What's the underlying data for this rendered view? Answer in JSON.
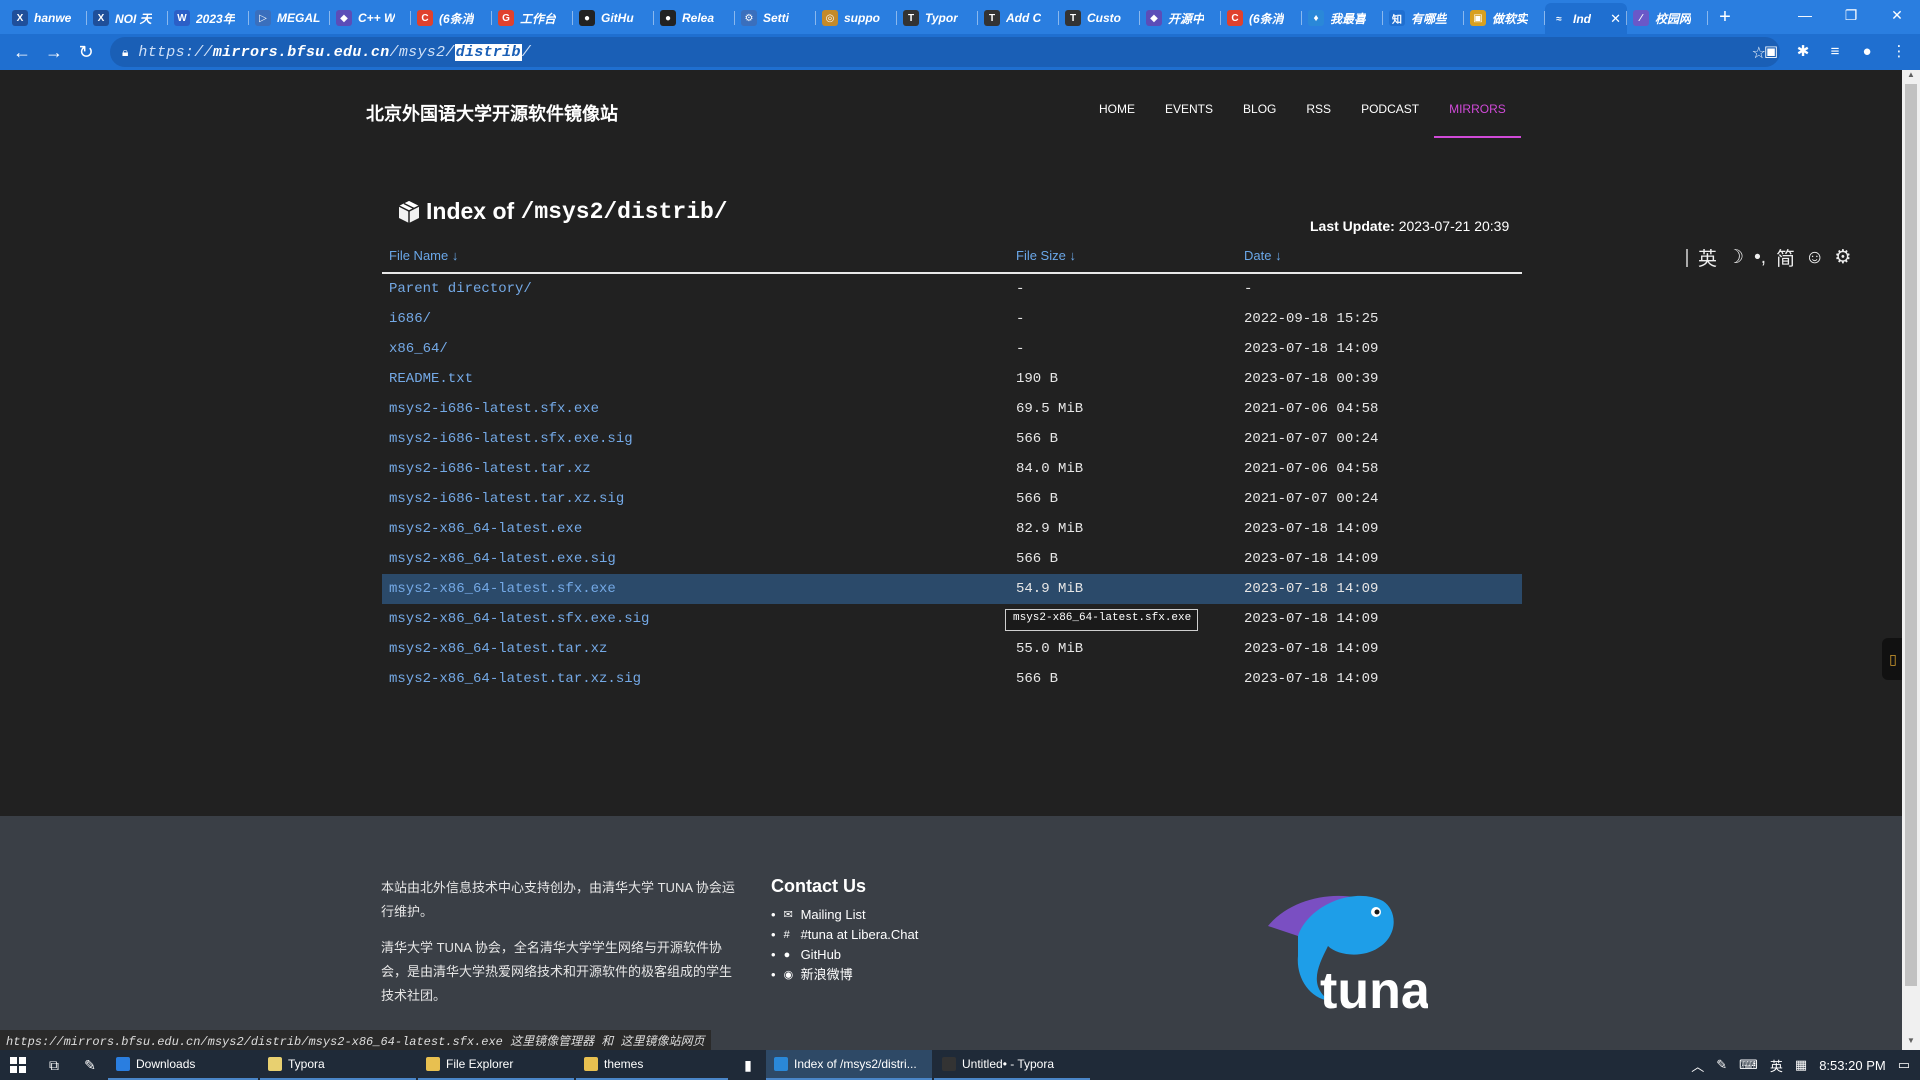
{
  "browser": {
    "tabs": [
      {
        "label": "hanwe",
        "icon": "X",
        "color": "#1f4f9a"
      },
      {
        "label": "NOI 天",
        "icon": "X",
        "color": "#1f4f9a"
      },
      {
        "label": "2023年",
        "icon": "W",
        "color": "#2b5fc7"
      },
      {
        "label": "MEGAL",
        "icon": "▷",
        "color": "#3a6fbd"
      },
      {
        "label": "C++ W",
        "icon": "◆",
        "color": "#5b4db8"
      },
      {
        "label": "(6条消",
        "icon": "C",
        "color": "#e0412d"
      },
      {
        "label": "工作台",
        "icon": "G",
        "color": "#e0412d"
      },
      {
        "label": "GitHu",
        "icon": "●",
        "color": "#222222"
      },
      {
        "label": "Relea",
        "icon": "●",
        "color": "#222222"
      },
      {
        "label": "Setti",
        "icon": "⚙",
        "color": "#3a6fbd"
      },
      {
        "label": "suppo",
        "icon": "◎",
        "color": "#c48a2a"
      },
      {
        "label": "Typor",
        "icon": "T",
        "color": "#333333"
      },
      {
        "label": "Add C",
        "icon": "T",
        "color": "#333333"
      },
      {
        "label": "Custo",
        "icon": "T",
        "color": "#333333"
      },
      {
        "label": "开源中",
        "icon": "◆",
        "color": "#5b4db8"
      },
      {
        "label": "(6条消",
        "icon": "C",
        "color": "#e0412d"
      },
      {
        "label": "我最喜",
        "icon": "♦",
        "color": "#2a88d8"
      },
      {
        "label": "有哪些",
        "icon": "知",
        "color": "#1f6fd0"
      },
      {
        "label": "做软实",
        "icon": "▣",
        "color": "#d8a020"
      },
      {
        "label": "Ind",
        "icon": "≈",
        "color": "#1f6fd0",
        "active": true
      },
      {
        "label": "校园网",
        "icon": "∕",
        "color": "#6a58c8"
      }
    ],
    "new_tab": "+",
    "url_scheme": "https://",
    "url_host": "mirrors.bfsu.edu.cn",
    "url_path": "/msys2/",
    "url_selected": "distrib",
    "url_tail": "/"
  },
  "site": {
    "title": "北京外国语大学开源软件镜像站",
    "nav": [
      "HOME",
      "EVENTS",
      "BLOG",
      "RSS",
      "PODCAST",
      "MIRRORS"
    ],
    "active_nav": "MIRRORS"
  },
  "index": {
    "title_prefix": "Index of",
    "path": "/msys2/distrib/",
    "last_update_label": "Last Update:",
    "last_update_value": "2023-07-21 20:39",
    "columns": [
      "File Name ↓",
      "File Size ↓",
      "Date ↓"
    ],
    "rows": [
      {
        "name": "Parent directory/",
        "size": "-",
        "date": "-"
      },
      {
        "name": "i686/",
        "size": "-",
        "date": "2022-09-18 15:25"
      },
      {
        "name": "x86_64/",
        "size": "-",
        "date": "2023-07-18 14:09"
      },
      {
        "name": "README.txt",
        "size": "190 B",
        "date": "2023-07-18 00:39"
      },
      {
        "name": "msys2-i686-latest.sfx.exe",
        "size": "69.5 MiB",
        "date": "2021-07-06 04:58"
      },
      {
        "name": "msys2-i686-latest.sfx.exe.sig",
        "size": "566 B",
        "date": "2021-07-07 00:24"
      },
      {
        "name": "msys2-i686-latest.tar.xz",
        "size": "84.0 MiB",
        "date": "2021-07-06 04:58"
      },
      {
        "name": "msys2-i686-latest.tar.xz.sig",
        "size": "566 B",
        "date": "2021-07-07 00:24"
      },
      {
        "name": "msys2-x86_64-latest.exe",
        "size": "82.9 MiB",
        "date": "2023-07-18 14:09"
      },
      {
        "name": "msys2-x86_64-latest.exe.sig",
        "size": "566 B",
        "date": "2023-07-18 14:09"
      },
      {
        "name": "msys2-x86_64-latest.sfx.exe",
        "size": "54.9 MiB",
        "date": "2023-07-18 14:09"
      },
      {
        "name": "msys2-x86_64-latest.sfx.exe.sig",
        "size": "566 B",
        "date": "2023-07-18 14:09"
      },
      {
        "name": "msys2-x86_64-latest.tar.xz",
        "size": "55.0 MiB",
        "date": "2023-07-18 14:09"
      },
      {
        "name": "msys2-x86_64-latest.tar.xz.sig",
        "size": "566 B",
        "date": "2023-07-18 14:09"
      }
    ],
    "highlighted_row": 10,
    "tooltip": "msys2-x86_64-latest.sfx.exe"
  },
  "side_tools": [
    "英",
    "☽",
    "•,",
    "简",
    "☺",
    "⚙"
  ],
  "footer": {
    "about_1": "本站由北外信息技术中心支持创办，由清华大学 TUNA 协会运行维护。",
    "about_2": "清华大学 TUNA 协会，全名清华大学学生网络与开源软件协会，是由清华大学热爱网络技术和开源软件的极客组成的学生技术社团。",
    "contact_title": "Contact Us",
    "contacts": [
      {
        "icon": "✉",
        "label": "Mailing List"
      },
      {
        "icon": "#",
        "label": "#tuna at Libera.Chat"
      },
      {
        "icon": "●",
        "label": "GitHub"
      },
      {
        "icon": "◉",
        "label": "新浪微博"
      }
    ],
    "logo_text": "tuna"
  },
  "status_url": "https://mirrors.bfsu.edu.cn/msys2/distrib/msys2-x86_64-latest.sfx.exe 这里镜像管理器 和 这里镜像站网页",
  "taskbar": {
    "apps": [
      {
        "label": "Downloads",
        "color": "#2a7ee0"
      },
      {
        "label": "Typora",
        "color": "#e8d070"
      },
      {
        "label": "File Explorer",
        "color": "#e8c050"
      },
      {
        "label": "themes",
        "color": "#e8c050"
      },
      {
        "label": "Index of /msys2/distri...",
        "color": "#2a88d8",
        "active": true
      },
      {
        "label": "Untitled• - Typora",
        "color": "#333333"
      }
    ],
    "ime": "英",
    "time": "8:53:20 PM"
  }
}
